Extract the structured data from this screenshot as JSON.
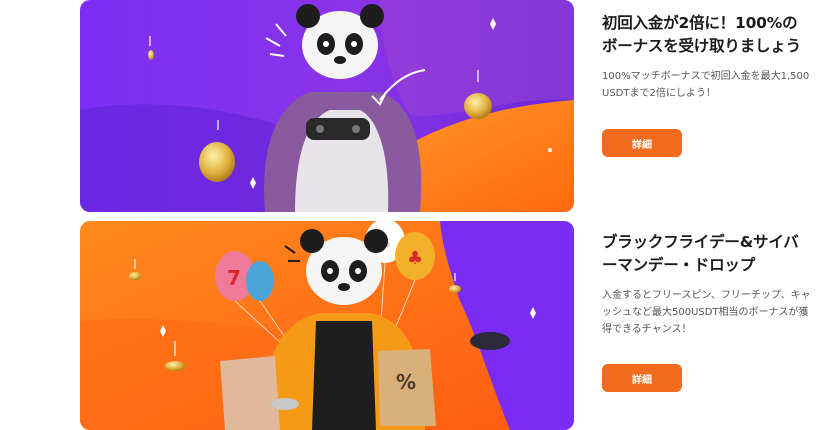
{
  "colors": {
    "accent": "#f26a1b",
    "title_text": "#1c1c1c",
    "body_text": "#555555",
    "banner_purple": "#7a2cf5",
    "banner_orange": "#ff7a1a"
  },
  "promos": [
    {
      "title": "初回入金が2倍に！100%のボーナスを受け取りましょう",
      "description": "100%マッチボーナスで初回入金を最大1,500 USDTまで2倍にしよう！",
      "button_label": "詳細",
      "image": "panda-with-controller-banner"
    },
    {
      "title": "ブラックフライデー&サイバーマンデー・ドロップ",
      "description": "入金するとフリースピン、フリーチップ、キャッシュなど最大500USDT相当のボーナスが獲得できるチャンス！",
      "button_label": "詳細",
      "image": "panda-with-balloons-banner"
    }
  ]
}
